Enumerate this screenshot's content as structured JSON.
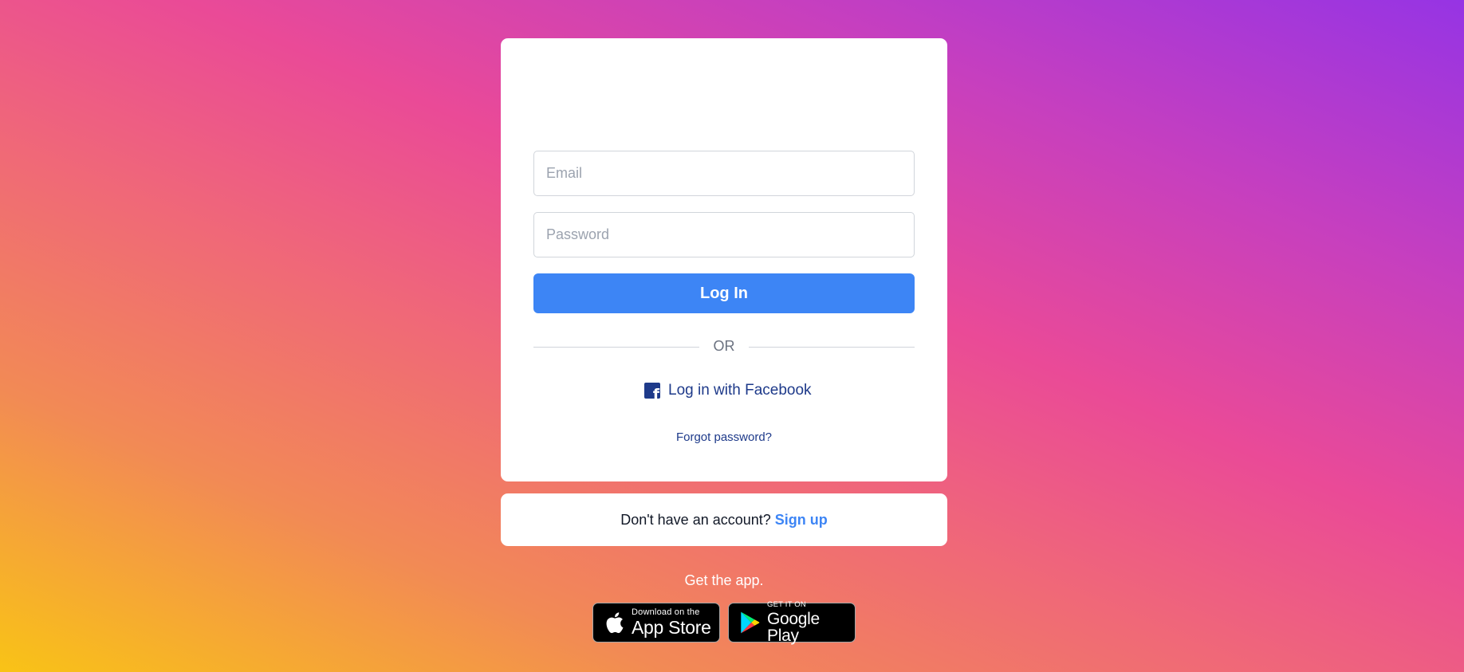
{
  "login": {
    "email_placeholder": "Email",
    "password_placeholder": "Password",
    "login_button": "Log In",
    "divider_text": "OR",
    "facebook_login": "Log in with Facebook",
    "forgot_password": "Forgot password?"
  },
  "signup": {
    "prompt": "Don't have an account?",
    "link": "Sign up"
  },
  "app": {
    "get_app_text": "Get the app.",
    "app_store": {
      "small": "Download on the",
      "big": "App Store"
    },
    "google_play": {
      "small": "GET IT ON",
      "big": "Google Play"
    }
  },
  "colors": {
    "primary_button": "#3d85f5",
    "facebook_blue": "#1e3a8a",
    "link_blue": "#3d85f5",
    "card_background": "#ffffff",
    "gradient_start": "#f9c316",
    "gradient_middle": "#ea4a97",
    "gradient_end": "#9634e4"
  },
  "icons": {
    "facebook": "facebook-icon",
    "apple": "apple-icon",
    "google_play": "google-play-icon"
  }
}
